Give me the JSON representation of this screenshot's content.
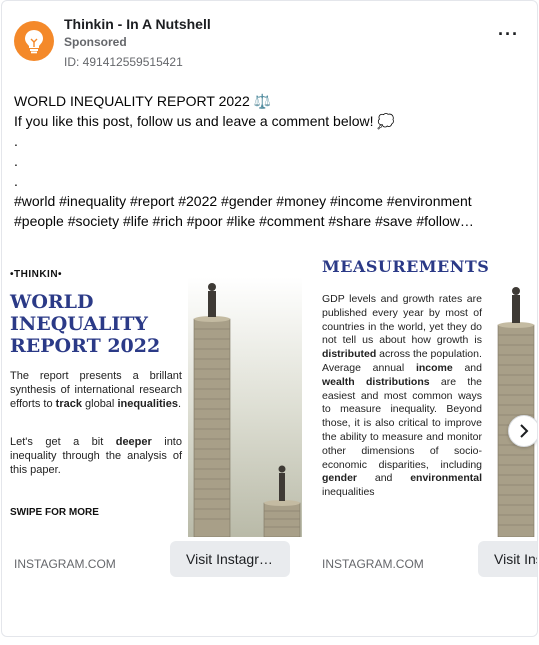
{
  "header": {
    "page_name": "Thinkin - In A Nutshell",
    "sponsored": "Sponsored",
    "ad_id": "ID: 491412559515421",
    "avatar_icon": "lightbulb-icon",
    "more_icon": "more-options-icon"
  },
  "caption": {
    "line1": "WORLD INEQUALITY REPORT 2022 ⚖️",
    "line2": "If you like this post, follow us and leave a comment below! 💭",
    "dot1": ".",
    "dot2": ".",
    "dot3": ".",
    "hashtags1": "#world #inequality #report #2022 #gender #money #income #environment",
    "hashtags2": "#people #society #life #rich #poor #like #comment #share #save #follow…"
  },
  "cards": [
    {
      "brand": "•THINKIN•",
      "title_l1": "WORLD",
      "title_l2": "INEQUALITY",
      "title_l3": "REPORT 2022",
      "p1_a": "The report presents a brillant synthesis of international research efforts to ",
      "p1_b": "track",
      "p1_c": " global ",
      "p1_d": "inequalities",
      "p1_e": ".",
      "p2_a": "Let's get a bit ",
      "p2_b": "deeper",
      "p2_c": " into inequality through the analysis of this paper.",
      "swipe": "SWIPE FOR MORE",
      "domain": "INSTAGRAM.COM",
      "cta": "Visit Instagr…"
    },
    {
      "title": "MEASUREMENTS",
      "b1": "GDP levels and growth rates are published every year by most of countries in the world, yet they do not tell us about how growth is ",
      "b2": "distributed",
      "b3": " across the population.",
      "b4": "Average annual ",
      "b5": "income",
      "b6": " and ",
      "b7": "wealth distributions",
      "b8": " are the easiest and most common ways to measure inequality. Beyond those, it is also critical to improve the ability to measure and monitor other dimensions of socio- economic disparities, including ",
      "b9": "gender",
      "b10": " and ",
      "b11": "environmental",
      "b12": " inequalities",
      "domain": "INSTAGRAM.COM",
      "cta": "Visit Ins"
    }
  ],
  "carousel": {
    "next_icon": "chevron-right-icon"
  }
}
